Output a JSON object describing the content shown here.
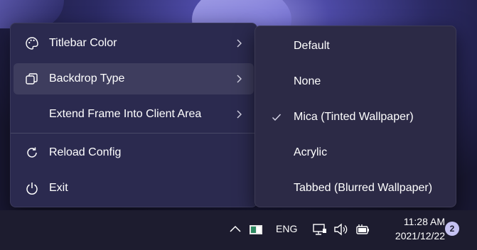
{
  "main_menu": {
    "items": [
      {
        "label": "Titlebar Color",
        "icon": "palette-icon",
        "has_submenu": true
      },
      {
        "label": "Backdrop Type",
        "icon": "backdrop-icon",
        "has_submenu": true
      },
      {
        "label": "Extend Frame Into Client Area",
        "icon": "",
        "has_submenu": true
      },
      {
        "label": "Reload Config",
        "icon": "reload-icon",
        "has_submenu": false
      },
      {
        "label": "Exit",
        "icon": "power-icon",
        "has_submenu": false
      }
    ]
  },
  "sub_menu": {
    "items": [
      {
        "label": "Default",
        "checked": false
      },
      {
        "label": "None",
        "checked": false
      },
      {
        "label": "Mica (Tinted Wallpaper)",
        "checked": true
      },
      {
        "label": "Acrylic",
        "checked": false
      },
      {
        "label": "Tabbed (Blurred Wallpaper)",
        "checked": false
      }
    ]
  },
  "taskbar": {
    "tray_icons": [
      "chevron-up-icon",
      "app-tray-icon",
      "network-icon",
      "volume-icon",
      "battery-icon"
    ],
    "language": "ENG",
    "time": "11:28 AM",
    "date": "2021/12/22",
    "notification_count": "2"
  },
  "colors": {
    "menu_bg": "#2b2a4f",
    "submenu_bg": "#2c2a46",
    "taskbar_bg": "#1d1c2f",
    "badge": "#c5c2f2"
  }
}
